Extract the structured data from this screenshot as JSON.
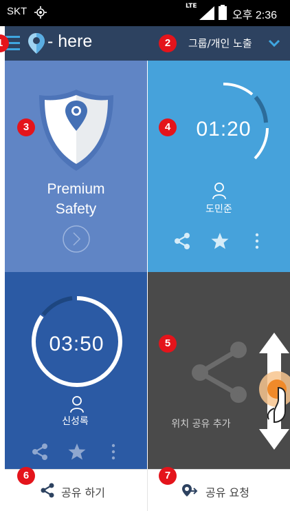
{
  "status_bar": {
    "carrier": "SKT",
    "network": "LTE",
    "time": "오후 2:36"
  },
  "header": {
    "app_name": "- here",
    "exposure_label": "그룹/개인 노출"
  },
  "tiles": {
    "premium": {
      "title_line1": "Premium",
      "title_line2": "Safety"
    },
    "friend1": {
      "timer": "01:20",
      "name": "도민준",
      "remaining": 0.62
    },
    "friend2": {
      "timer": "03:50",
      "name": "신성록",
      "remaining": 0.9
    },
    "add_share": {
      "label": "위치 공유 추가"
    }
  },
  "bottom_bar": {
    "share_label": "공유 하기",
    "request_label": "공유 요청"
  },
  "badges": [
    "1",
    "2",
    "3",
    "4",
    "5",
    "6",
    "7"
  ],
  "colors": {
    "header": "#2d4260",
    "accent": "#3fa7e1",
    "badge": "#e4141b",
    "premium_tile": "#6085c5",
    "friend1_tile": "#46a2db",
    "friend2_tile": "#2b5aa4",
    "add_tile": "#4a4a4a"
  }
}
